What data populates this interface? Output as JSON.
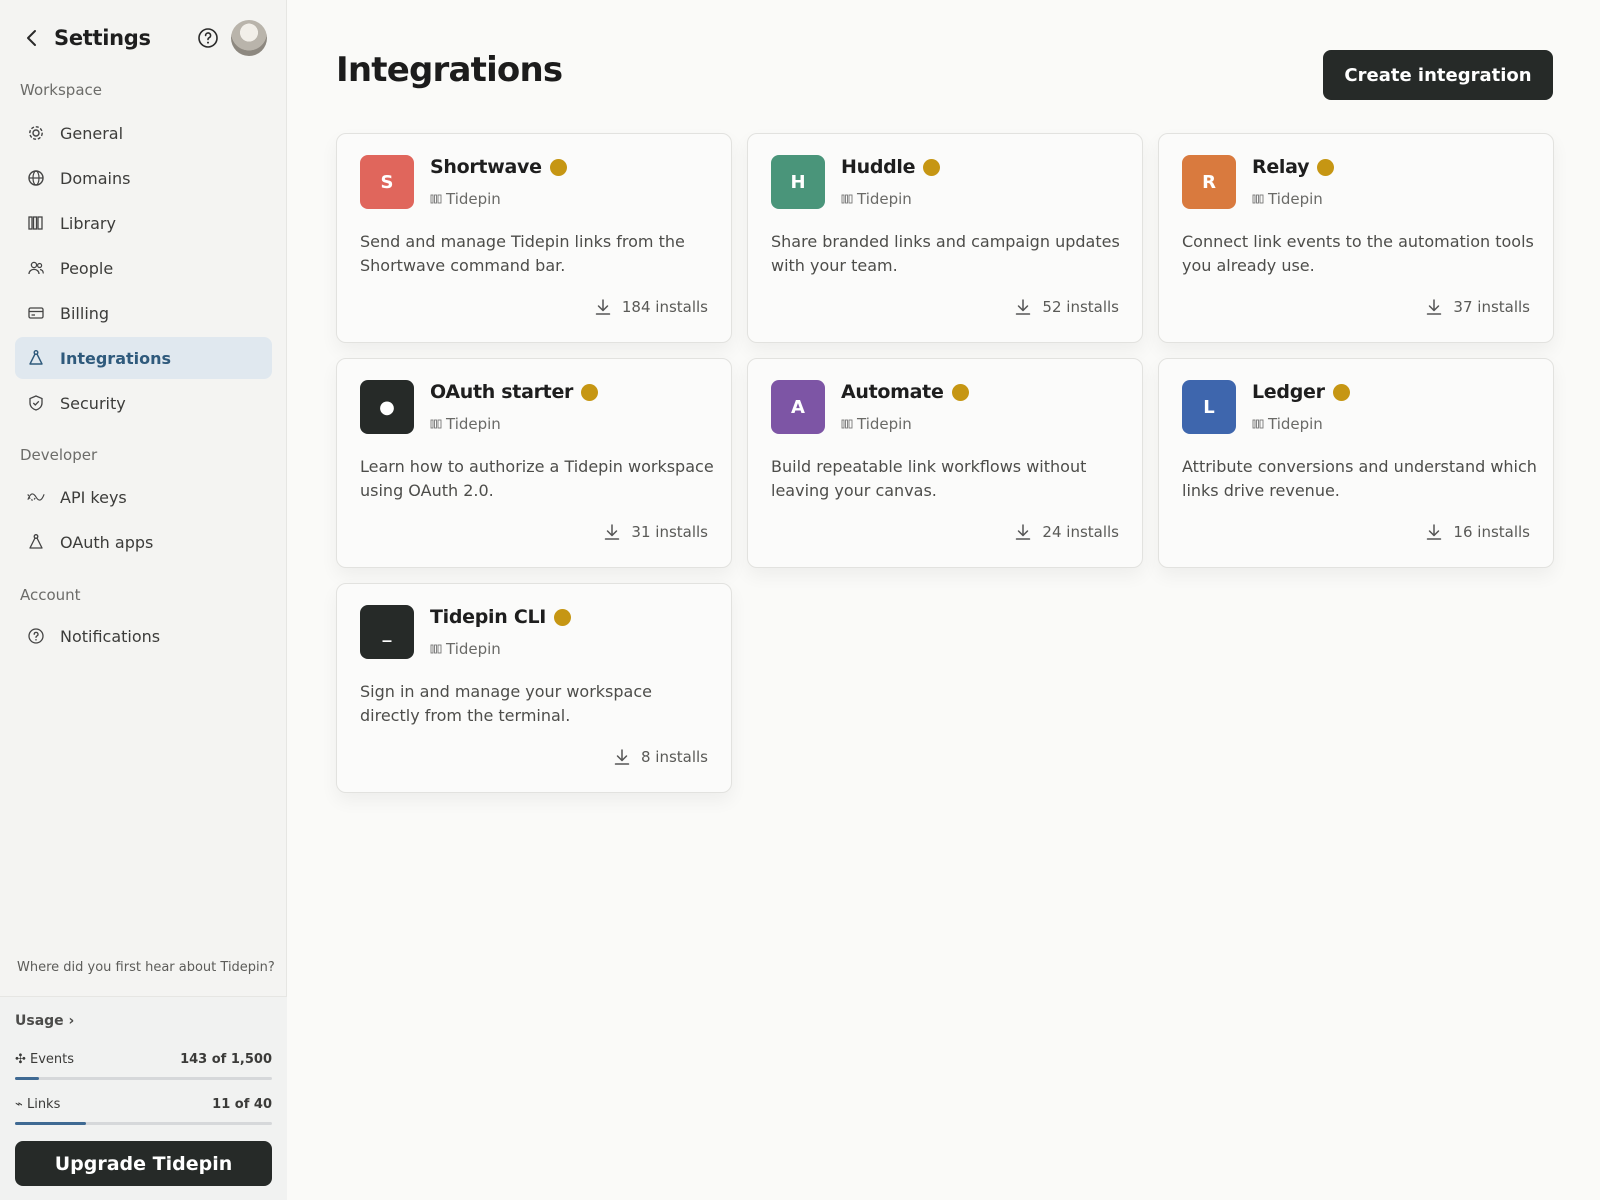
{
  "sidebar": {
    "title": "Settings",
    "sections": {
      "workspace": "Workspace",
      "developer": "Developer",
      "account": "Account"
    },
    "items": [
      {
        "label": "General",
        "icon": "gear-icon"
      },
      {
        "label": "Domains",
        "icon": "globe-icon"
      },
      {
        "label": "Library",
        "icon": "library-icon"
      },
      {
        "label": "People",
        "icon": "people-icon"
      },
      {
        "label": "Billing",
        "icon": "card-icon"
      },
      {
        "label": "Integrations",
        "icon": "integrations-icon",
        "active": true
      },
      {
        "label": "Security",
        "icon": "shield-icon"
      },
      {
        "label": "API keys",
        "icon": "api-icon"
      },
      {
        "label": "OAuth apps",
        "icon": "oauth-icon"
      },
      {
        "label": "Notifications",
        "icon": "bell-icon"
      }
    ],
    "survey": "Where did you first hear about Tidepin?",
    "usage": {
      "title": "Usage ›",
      "events_label": "✣ Events",
      "events_value": "143 of 1,500",
      "events_progress": 0.0953,
      "links_label": "⌁ Links",
      "links_value": "11 of 40",
      "links_progress": 0.275
    },
    "upgrade_label": "Upgrade Tidepin"
  },
  "main": {
    "title": "Integrations",
    "create_label": "Create integration",
    "cards": [
      {
        "name": "Shortwave",
        "letter": "S",
        "color": "#e0665c",
        "org": "Tidepin",
        "desc": "Send and manage Tidepin links from the Shortwave command bar.",
        "installs": "184 installs"
      },
      {
        "name": "Huddle",
        "letter": "H",
        "color": "#4a957a",
        "org": "Tidepin",
        "desc": "Share branded links and campaign updates with your team.",
        "installs": "52 installs"
      },
      {
        "name": "Relay",
        "letter": "R",
        "color": "#d97a3e",
        "org": "Tidepin",
        "desc": "Connect link events to the automation tools you already use.",
        "installs": "37 installs"
      },
      {
        "name": "OAuth starter",
        "letter": "●",
        "color": "#262a28",
        "org": "Tidepin",
        "desc": "Learn how to authorize a Tidepin workspace using OAuth 2.0.",
        "installs": "31 installs"
      },
      {
        "name": "Automate",
        "letter": "A",
        "color": "#7d55a5",
        "org": "Tidepin",
        "desc": "Build repeatable link workflows without leaving your canvas.",
        "installs": "24 installs"
      },
      {
        "name": "Ledger",
        "letter": "L",
        "color": "#3e66ad",
        "org": "Tidepin",
        "desc": "Attribute conversions and understand which links drive revenue.",
        "installs": "16 installs"
      },
      {
        "name": "Tidepin CLI",
        "letter": "_",
        "color": "#262a28",
        "org": "Tidepin",
        "desc": "Sign in and manage your workspace directly from the terminal.",
        "installs": "8 installs"
      }
    ],
    "verified_color": "#c69613"
  }
}
